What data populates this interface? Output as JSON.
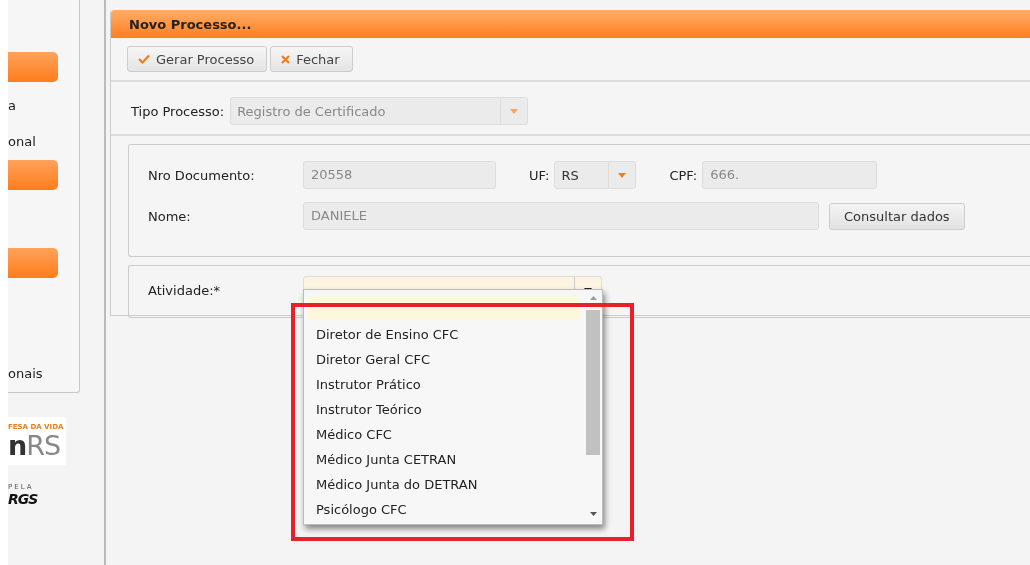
{
  "sidebar": {
    "items": [
      {
        "kind": "button"
      },
      {
        "kind": "text",
        "label": "a"
      },
      {
        "kind": "text",
        "label": "onal"
      },
      {
        "kind": "button"
      },
      {
        "kind": "spacer"
      },
      {
        "kind": "button"
      },
      {
        "kind": "spacer"
      },
      {
        "kind": "text",
        "label": "onais"
      }
    ],
    "logos": [
      {
        "tagline": "FESA DA VIDA",
        "wordmark": "**n**RS"
      },
      {
        "tagline": "PELA",
        "wordmark": "RGS"
      }
    ]
  },
  "panel": {
    "title": "Novo Processo...",
    "toolbar": [
      {
        "kind": "confirm",
        "label": "Gerar Processo"
      },
      {
        "kind": "close",
        "label": "Fechar"
      }
    ],
    "tipo_processo": {
      "label": "Tipo Processo:",
      "value": "Registro de Certificado",
      "disabled": true
    },
    "documento": {
      "nro_label": "Nro Documento:",
      "nro_value": "20558",
      "uf_label": "UF:",
      "uf_value": "RS",
      "cpf_label": "CPF:",
      "cpf_value": "666.",
      "nome_label": "Nome:",
      "nome_value": "DANIELE",
      "consult_button": "Consultar dados"
    },
    "atividade": {
      "label": "Atividade:*",
      "open": true,
      "options": [
        {
          "selected": true
        },
        {
          "label": "Diretor de Ensino CFC",
          "selected": false
        },
        {
          "label": "Diretor Geral CFC",
          "selected": false
        },
        {
          "label": "Instrutor Prático",
          "selected": false
        },
        {
          "label": "Instrutor Teórico",
          "selected": false
        },
        {
          "label": "Médico CFC",
          "selected": false
        },
        {
          "label": "Médico Junta CETRAN",
          "selected": false
        },
        {
          "label": "Médico Junta do DETRAN",
          "selected": false
        },
        {
          "label": "Psicólogo CFC",
          "selected": false
        }
      ],
      "highlighted": true
    }
  }
}
